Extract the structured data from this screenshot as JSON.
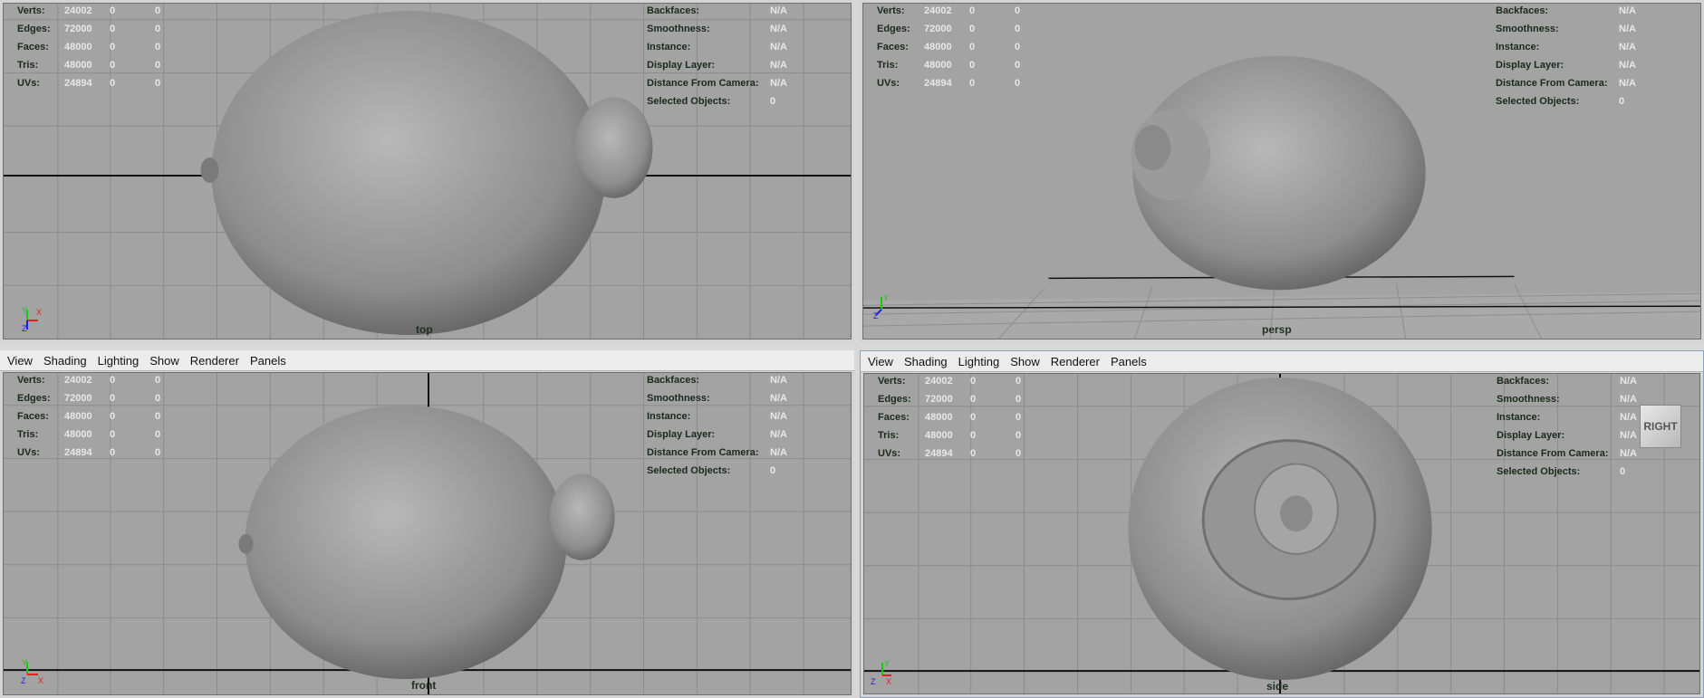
{
  "menu": [
    "View",
    "Shading",
    "Lighting",
    "Show",
    "Renderer",
    "Panels"
  ],
  "stats": [
    {
      "label": "Verts:",
      "v1": "24002",
      "v2": "0",
      "v3": "0"
    },
    {
      "label": "Edges:",
      "v1": "72000",
      "v2": "0",
      "v3": "0"
    },
    {
      "label": "Faces:",
      "v1": "48000",
      "v2": "0",
      "v3": "0"
    },
    {
      "label": "Tris:",
      "v1": "48000",
      "v2": "0",
      "v3": "0"
    },
    {
      "label": "UVs:",
      "v1": "24894",
      "v2": "0",
      "v3": "0"
    }
  ],
  "info": [
    {
      "label": "Backfaces:",
      "val": "N/A"
    },
    {
      "label": "Smoothness:",
      "val": "N/A"
    },
    {
      "label": "Instance:",
      "val": "N/A"
    },
    {
      "label": "Display Layer:",
      "val": "N/A"
    },
    {
      "label": "Distance From Camera:",
      "val": "N/A"
    },
    {
      "label": "Selected Objects:",
      "val": "0"
    }
  ],
  "cameras": {
    "top": "top",
    "persp": "persp",
    "front": "front",
    "side": "side"
  },
  "viewcube": "RIGHT",
  "axes": {
    "top": [
      "Y",
      "X",
      "Z"
    ],
    "persp": [
      "Y",
      "Z",
      "X"
    ],
    "front": [
      "Y",
      "Z",
      "X"
    ],
    "side": [
      "Y",
      "Z",
      "X"
    ]
  },
  "colors": {
    "viewport": "#a3a3a3",
    "grid": "#8c8c8c",
    "model": "#9a9a9a",
    "axis_x": "#d22",
    "axis_y": "#1c1",
    "axis_z": "#22d"
  }
}
